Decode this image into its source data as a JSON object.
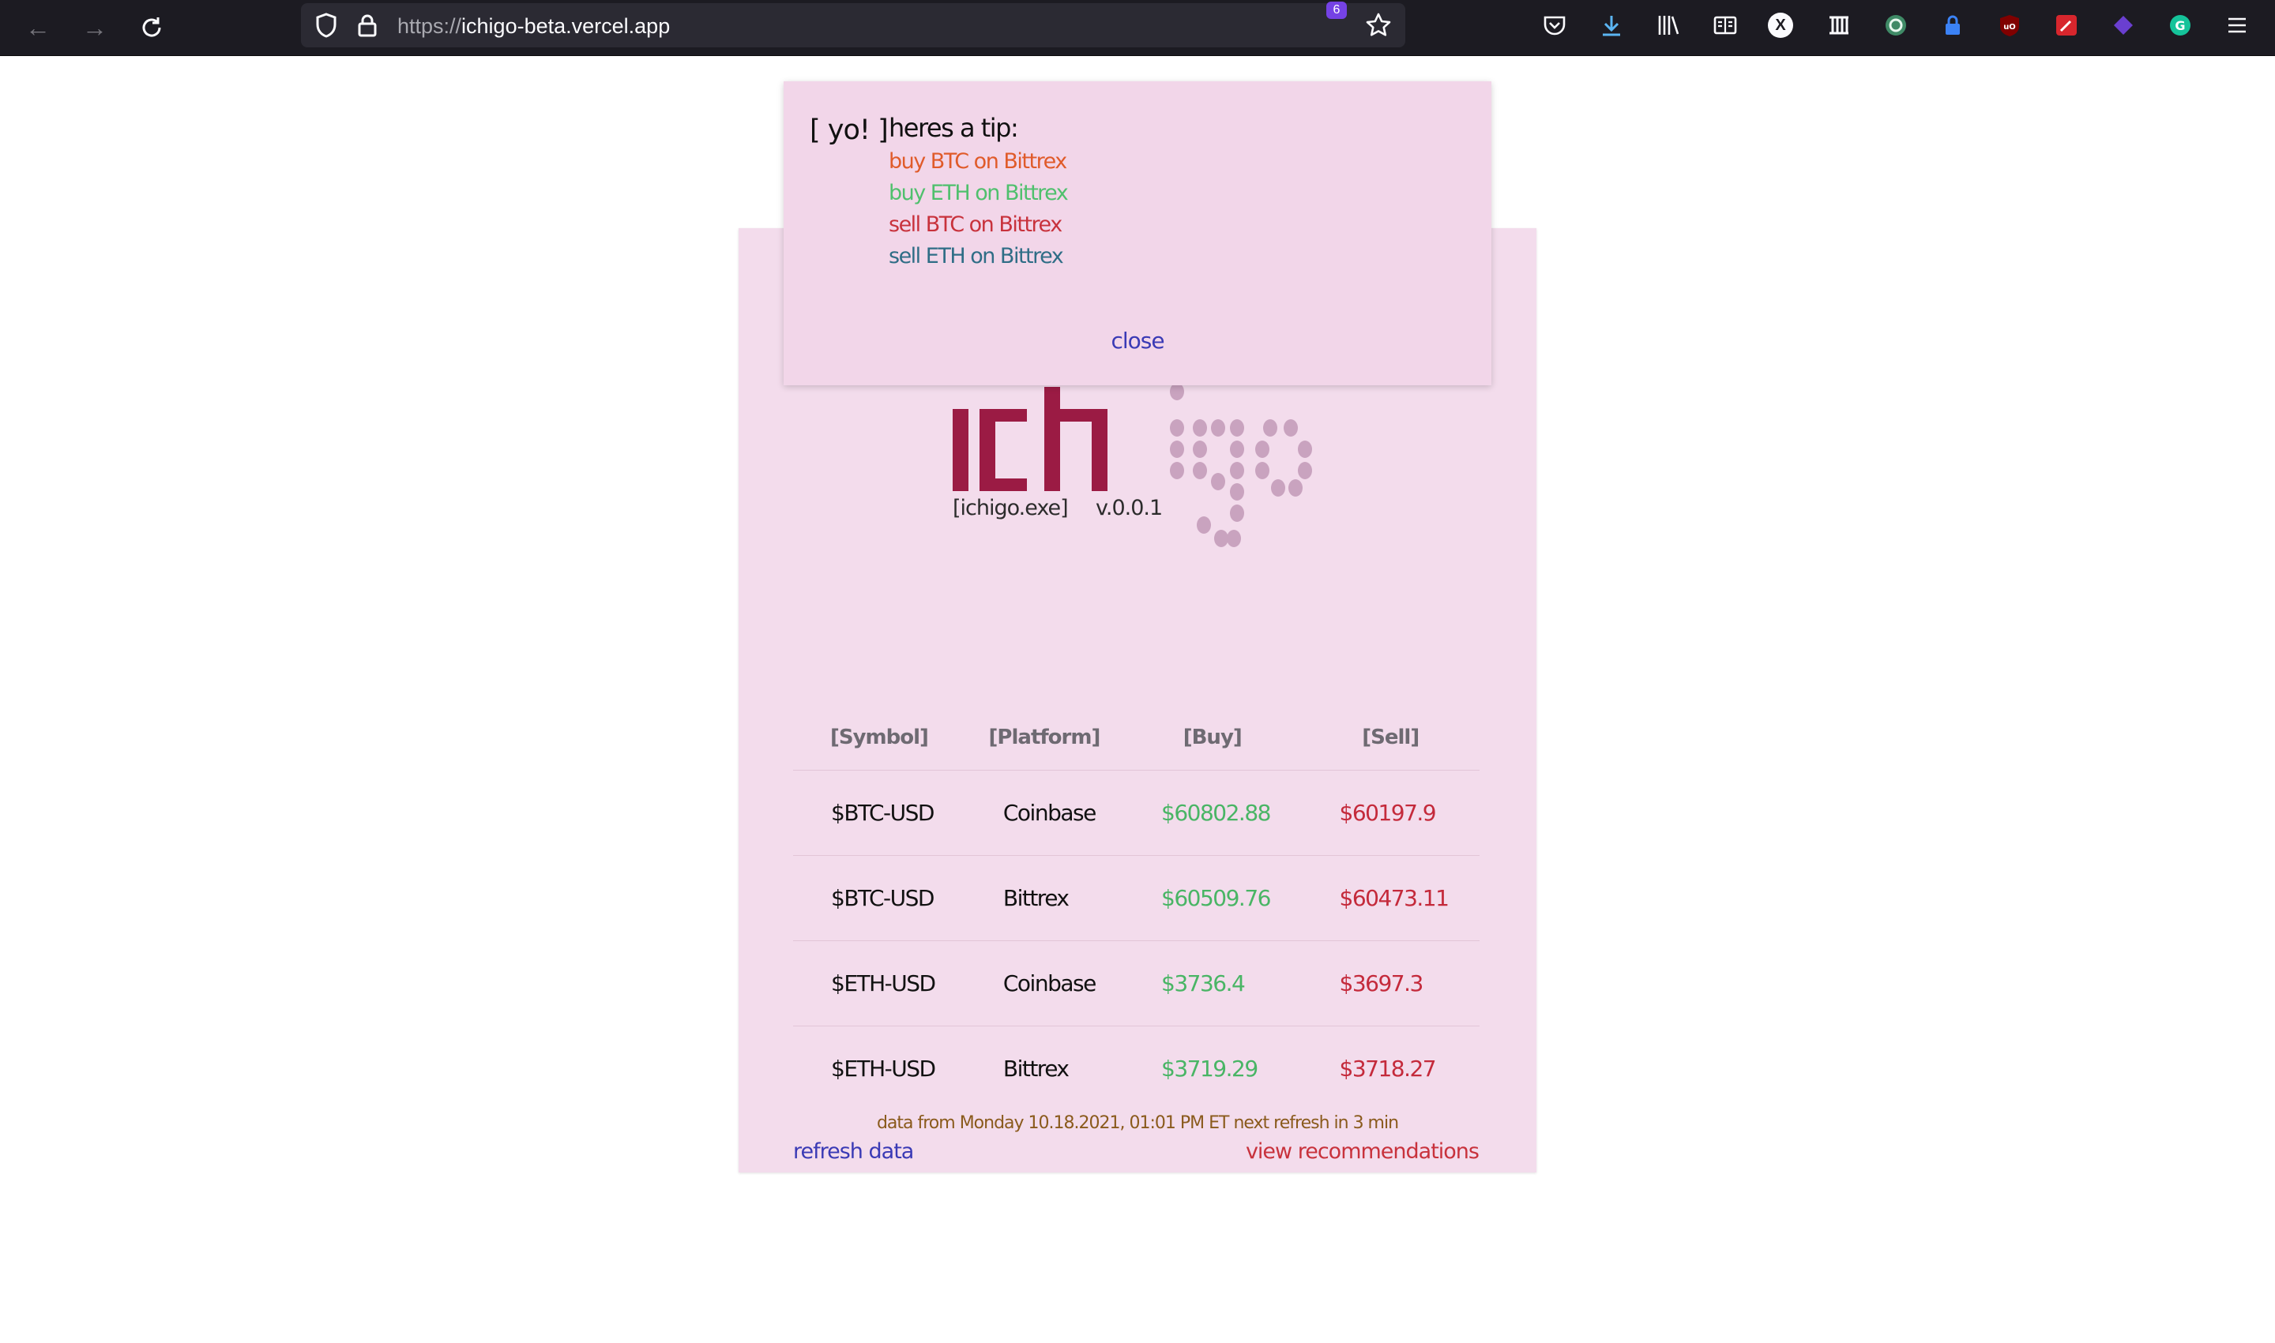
{
  "browser": {
    "url_protocol": "https://",
    "url_host": "ichigo-beta.vercel.app",
    "extensions_badge": "6"
  },
  "toast": {
    "tag": "[ yo! ]",
    "title": "heres a tip:",
    "tips": [
      "buy BTC on Bittrex",
      "buy ETH on Bittrex",
      "sell BTC on Bittrex",
      "sell ETH on Bittrex"
    ],
    "close_label": "close"
  },
  "logo": {
    "filename": "[ichigo.exe]",
    "version": "v.0.0.1"
  },
  "table": {
    "headers": [
      "[Symbol]",
      "[Platform]",
      "[Buy]",
      "[Sell]"
    ],
    "rows": [
      {
        "symbol": "$BTC-USD",
        "platform": "Coinbase",
        "buy": "$60802.88",
        "sell": "$60197.9"
      },
      {
        "symbol": "$BTC-USD",
        "platform": "Bittrex",
        "buy": "$60509.76",
        "sell": "$60473.11"
      },
      {
        "symbol": "$ETH-USD",
        "platform": "Coinbase",
        "buy": "$3736.4",
        "sell": "$3697.3"
      },
      {
        "symbol": "$ETH-USD",
        "platform": "Bittrex",
        "buy": "$3719.29",
        "sell": "$3718.27"
      }
    ]
  },
  "footer": {
    "note": "data from Monday 10.18.2021, 01:01 PM ET next refresh in 3 min",
    "refresh_label": "refresh data",
    "recommendations_label": "view recommendations"
  },
  "colors": {
    "panel_bg": "#f3dcec",
    "logo_red": "#9b1b44",
    "logo_dots": "#c9a3bf",
    "buy_green": "#49b565",
    "sell_red": "#c42a3b"
  }
}
